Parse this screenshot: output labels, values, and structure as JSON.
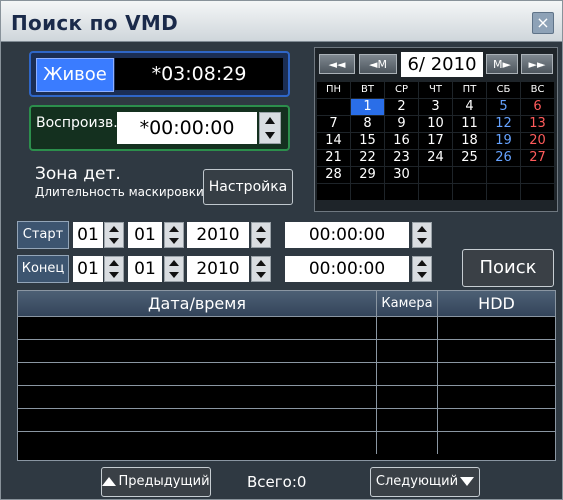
{
  "window": {
    "title": "Поиск по VMD",
    "close_icon": "×"
  },
  "live": {
    "label": "Живое",
    "time": "*03:08:29"
  },
  "playback": {
    "label": "Воспроизв.",
    "time": "*00:00:00"
  },
  "zone": {
    "title": "Зона дет.",
    "subtitle": "Длительность маскировки",
    "setup_label": "Настройка"
  },
  "calendar": {
    "nav": {
      "prev_year": "◄◄",
      "prev_month": "◄M",
      "next_month": "M►",
      "next_year": "►►"
    },
    "month_label": "6/ 2010",
    "weekdays": [
      "ПН",
      "ВТ",
      "СР",
      "ЧТ",
      "ПТ",
      "СБ",
      "ВС"
    ],
    "weeks": [
      [
        "",
        "1",
        "2",
        "3",
        "4",
        "5",
        "6"
      ],
      [
        "7",
        "8",
        "9",
        "10",
        "11",
        "12",
        "13"
      ],
      [
        "14",
        "15",
        "16",
        "17",
        "18",
        "19",
        "20"
      ],
      [
        "21",
        "22",
        "23",
        "24",
        "25",
        "26",
        "27"
      ],
      [
        "28",
        "29",
        "30",
        "",
        "",
        "",
        ""
      ],
      [
        "",
        "",
        "",
        "",
        "",
        "",
        ""
      ]
    ],
    "selected_day": "1",
    "colors": {
      "saturday": "#66a3ff",
      "sunday": "#ff5b5b",
      "selected_bg": "#2a6ee8"
    }
  },
  "range": {
    "start": {
      "label": "Старт",
      "day": "01",
      "month": "01",
      "year": "2010",
      "time": "00:00:00"
    },
    "end": {
      "label": "Конец",
      "day": "01",
      "month": "01",
      "year": "2010",
      "time": "00:00:00"
    }
  },
  "search": {
    "label": "Поиск"
  },
  "table": {
    "headers": {
      "datetime": "Дата/время",
      "camera": "Камера",
      "hdd": "HDD"
    },
    "rows": [
      {
        "datetime": "",
        "camera": "",
        "hdd": ""
      },
      {
        "datetime": "",
        "camera": "",
        "hdd": ""
      },
      {
        "datetime": "",
        "camera": "",
        "hdd": ""
      },
      {
        "datetime": "",
        "camera": "",
        "hdd": ""
      },
      {
        "datetime": "",
        "camera": "",
        "hdd": ""
      },
      {
        "datetime": "",
        "camera": "",
        "hdd": ""
      }
    ]
  },
  "footer": {
    "prev_label": "Предыдущий",
    "total_label": "Всего:0",
    "next_label": "Следующий"
  }
}
